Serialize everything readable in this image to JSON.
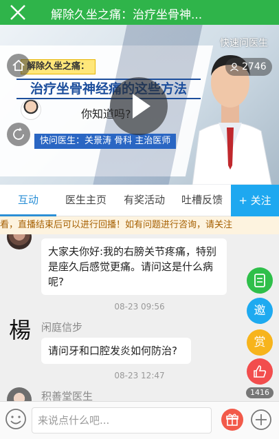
{
  "header": {
    "title": "解除久坐之痛：治疗坐骨神..."
  },
  "video": {
    "topic_tag": "解除久坐之痛：",
    "banner": "治疗坐骨神经痛的这些方法",
    "question": "你知道吗?",
    "doctor_line": "快问医生：关景涛 骨科 主治医师",
    "ask_doctor": "快速问医生",
    "viewers": "2746"
  },
  "tabs": [
    {
      "label": "互动"
    },
    {
      "label": "医生主页"
    },
    {
      "label": "有奖活动"
    },
    {
      "label": "吐槽反馈"
    }
  ],
  "follow_label": "+ 关注",
  "notice": "看，直播结束后可以进行回播！如有问题进行咨询，请关注",
  "messages": [
    {
      "text": "大家夫你好:我的右膀关节疼痛，特别是座久后感觉更痛。请问这是什么病呢?"
    },
    {
      "time": "08-23 09:56",
      "user": "闲庭信步",
      "avatar_char": "楊",
      "text": "请问牙和口腔发炎如何防治?"
    },
    {
      "time": "08-23 12:47",
      "user": "积善堂医生"
    }
  ],
  "fab": {
    "note_icon": "note-icon",
    "invite": "邀",
    "reward": "赏",
    "like_icon": "thumbs-up-icon",
    "like_count": "1416"
  },
  "bottom": {
    "input_placeholder": "来说点什么吧..."
  }
}
